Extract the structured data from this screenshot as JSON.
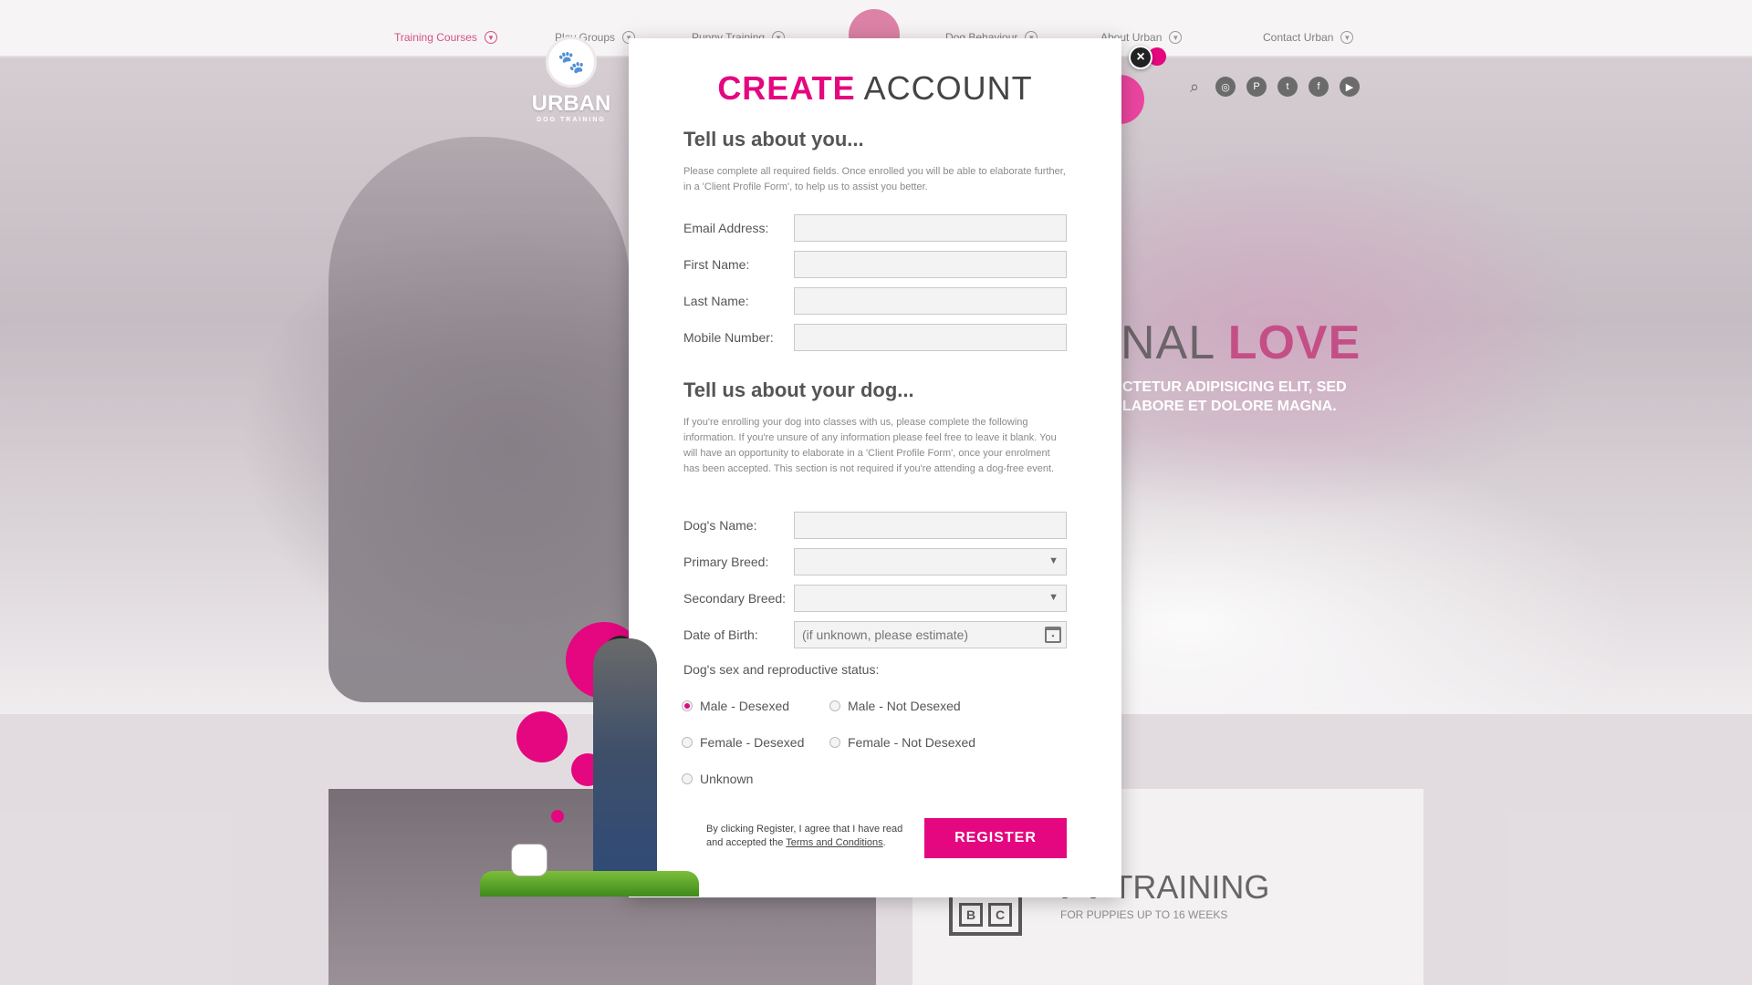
{
  "nav": {
    "items": [
      {
        "label": "Training Courses"
      },
      {
        "label": "Play Groups"
      },
      {
        "label": "Puppy Training"
      },
      {
        "label": "Dog Behaviour"
      },
      {
        "label": "About Urban"
      },
      {
        "label": "Contact Urban"
      }
    ]
  },
  "logo": {
    "word": "URBAN",
    "sub": "DOG TRAINING"
  },
  "hero": {
    "title_part1": "NAL ",
    "title_part2": "LOVE",
    "subtitle": "CTETUR ADIPISICING ELIT, SED LABORE ET DOLORE MAGNA."
  },
  "puppy": {
    "title_part1": "PY",
    "title_part2": " TRAINING",
    "sub": "FOR PUPPIES UP TO 16 WEEKS",
    "bc_b": "B",
    "bc_c": "C"
  },
  "modal": {
    "title_pink": "CREATE",
    "title_rest": " ACCOUNT",
    "close_symbol": "×",
    "about_you": {
      "heading": "Tell us about you...",
      "text": "Please complete all required fields. Once enrolled you will be able to elaborate further, in a 'Client Profile Form', to help us to assist you better.",
      "fields": {
        "email": "Email Address:",
        "first": "First Name:",
        "last": "Last Name:",
        "mobile": "Mobile Number:"
      }
    },
    "about_dog": {
      "heading": "Tell us about your dog...",
      "text": "If you're enrolling your dog into classes with us, please complete the following information. If you're unsure of any information please feel free to leave it blank. You will have an opportunity to elaborate in a 'Client Profile Form', once your enrolment has been accepted. This section is not required if you're attending a dog-free event.",
      "fields": {
        "dog_name": "Dog's Name:",
        "primary_breed": "Primary Breed:",
        "secondary_breed": "Secondary Breed:",
        "dob": "Date of Birth:",
        "dob_placeholder": "(if unknown, please estimate)"
      },
      "sex_label": "Dog's sex and reproductive status:",
      "options": {
        "male_desexed": "Male - Desexed",
        "male_not": "Male - Not Desexed",
        "female_desexed": "Female - Desexed",
        "female_not": "Female - Not Desexed",
        "unknown": "Unknown"
      },
      "selected": "male_desexed"
    },
    "terms_prefix": "By clicking Register, I agree that I have read and accepted the ",
    "terms_link": "Terms and Conditions",
    "terms_suffix": ".",
    "register_label": "REGISTER"
  },
  "colors": {
    "accent": "#e4077f",
    "brand_dark": "#b0155f"
  },
  "icons": [
    "search-icon",
    "instagram-icon",
    "pinterest-icon",
    "twitter-icon",
    "facebook-icon",
    "youtube-icon",
    "close-icon",
    "calendar-icon",
    "chevron-down-icon",
    "paw-icon"
  ]
}
